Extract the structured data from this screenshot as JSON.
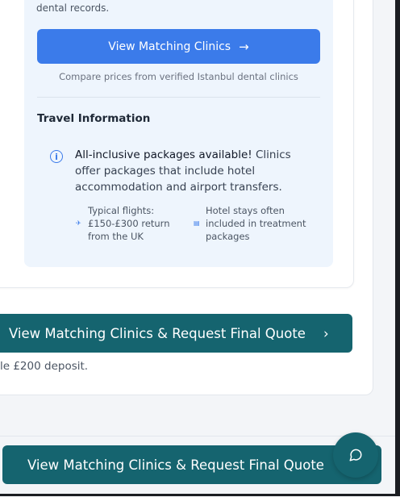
{
  "panel": {
    "records_text": "dental records.",
    "view_clinics_label": "View Matching Clinics",
    "compare_text": "Compare prices from verified Istanbul dental clinics"
  },
  "travel": {
    "title": "Travel Information",
    "info_bold": "All-inclusive packages available!",
    "info_rest": " Clinics offer packages that include hotel accommodation and airport transfers.",
    "flights": "Typical flights: £150-£300 return from the UK",
    "hotels": "Hotel stays often included in treatment packages"
  },
  "main_cta": {
    "label": "View Matching Clinics & Request Final Quote",
    "deposit_text": "le £200 deposit."
  },
  "sticky_cta": {
    "label": "View Matching Clinics & Request Final Quote"
  },
  "icons": [
    "arrow-right-icon",
    "info-icon",
    "plane-icon",
    "hotel-icon",
    "chevron-right-icon",
    "chat-icon"
  ],
  "colors": {
    "primary_blue": "#3b7bea",
    "teal": "#15646f",
    "panel_bg": "#eef5fd"
  }
}
